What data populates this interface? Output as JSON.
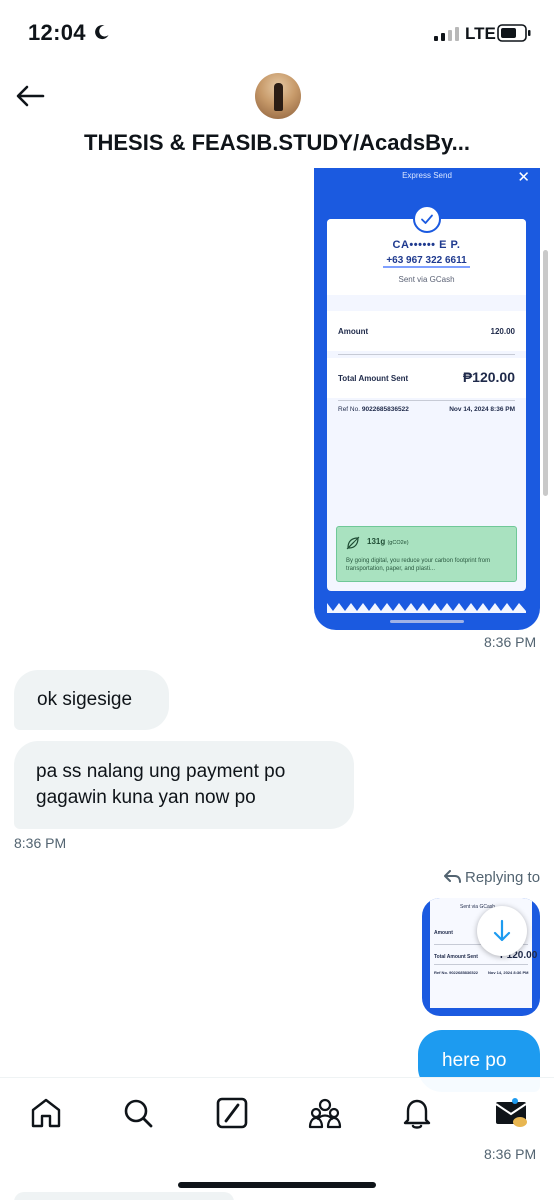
{
  "status_bar": {
    "time": "12:04",
    "network": "LTE",
    "icons": [
      "moon-icon",
      "signal-icon",
      "battery-icon"
    ]
  },
  "header": {
    "title": "THESIS & FEASIB.STUDY/AcadsBy...",
    "icons": [
      "back-arrow-icon",
      "avatar"
    ]
  },
  "messages": {
    "media": {
      "header_text": "Express Send",
      "close_glyph": "✕",
      "recipient_name": "CA•••••• E P.",
      "recipient_phone": "+63 967 322 6611",
      "sent_via": "Sent via GCash",
      "amount_label": "Amount",
      "amount_value": "120.00",
      "total_label": "Total Amount Sent",
      "total_value": "₱120.00",
      "ref_label": "Ref No.",
      "ref_number": "9022685836522",
      "date": "Nov 14, 2024 8:36 PM",
      "eco_amount": "131g",
      "eco_unit": "(gCO2e)",
      "eco_text": "By going digital, you reduce your carbon footprint from transportation, paper, and plasti...",
      "time": "8:36 PM"
    },
    "incoming": [
      {
        "text": "ok sigesige"
      },
      {
        "line1": "pa ss nalang ung payment po",
        "line2": "gagawin kuna yan now po"
      }
    ],
    "incoming_time": "8:36 PM",
    "replying_to": "Replying to",
    "reply_thumb": {
      "sent_via": "Sent via GCash",
      "amount_label": "Amount",
      "total_label": "Total Amount Sent",
      "total_value": "₱120.00",
      "ref": "Ref No. 9022685836522",
      "date": "Nov 14, 2024 8:36 PM"
    },
    "outgoing": {
      "text": "here po"
    },
    "outgoing_time": "8:36 PM"
  },
  "bottom_nav": {
    "items": [
      "home-icon",
      "search-icon",
      "grok-icon",
      "communities-icon",
      "notifications-icon",
      "messages-icon"
    ]
  },
  "colors": {
    "accent": "#1d9bf0",
    "gcash_blue": "#1b5ae0",
    "bubble_gray": "#eff3f4",
    "text_secondary": "#536471"
  }
}
